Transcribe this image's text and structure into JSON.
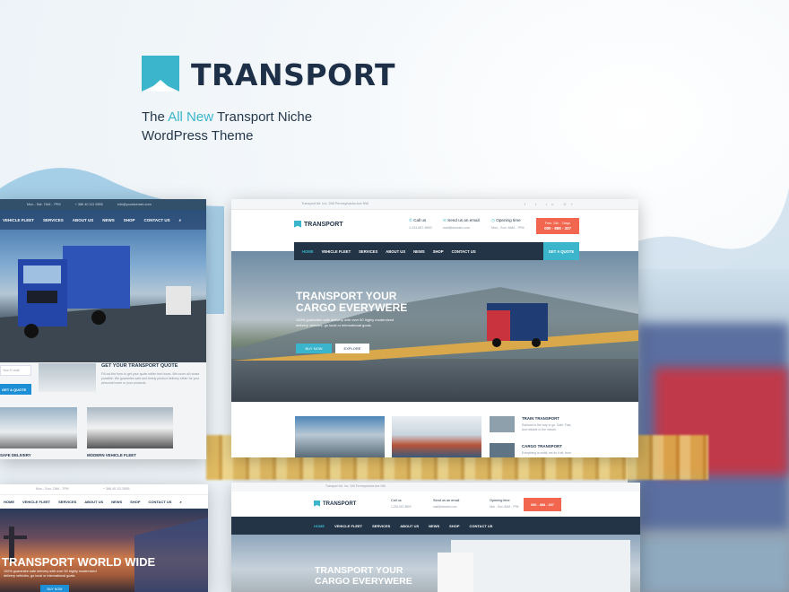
{
  "brand": {
    "name": "TRANSPORT",
    "tagline_pre": "The ",
    "tagline_hl": "All New",
    "tagline_post": " Transport Niche",
    "tagline_line2": "WordPress Theme",
    "accent": "#3ab5cb",
    "dark": "#1d3048"
  },
  "left_top": {
    "topbar": [
      "Mon - Sat: 7AM - 7PM",
      "+ 386 40 111 5555",
      "info@yourdomain.com"
    ],
    "nav": [
      "VEHICLE FLEET",
      "SERVICES",
      "ABOUT US",
      "NEWS",
      "SHOP",
      "CONTACT US"
    ],
    "quote_title": "GET YOUR TRANSPORT QUOTE",
    "quote_text": "Fill out the form to get your quote within few hours. We cover all routes possible. We guarantee safe and timely product delivery either for your personal home or your products.",
    "input_placeholder": "Your E-mail",
    "quote_button": "GET A QUOTE",
    "captions": [
      "SAFE DELIVERY",
      "MODERN VEHICLE FLEET"
    ]
  },
  "main": {
    "address": "Transport ltd. Inc. 208 Pennsylvania Ave NW",
    "social": "f  t  in  G+",
    "logo": "TRANSPORT",
    "call_title": "Call us",
    "call_sub": "1-234-567-8900",
    "email_title": "Send us an email",
    "email_sub": "mail@domain.com",
    "hours_title": "Opening time",
    "hours_sub": "Mon - Sun: 8AM - 7PM",
    "cta_top": "Free, 24h - 7days",
    "cta_phone": "080 - 888 - 337",
    "nav": [
      "HOME",
      "VEHICLE FLEET",
      "SERVICES",
      "ABOUT US",
      "NEWS",
      "SHOP",
      "CONTACT US"
    ],
    "get_quote": "GET A QUOTE",
    "hero_title_1": "TRANSPORT YOUR",
    "hero_title_2": "CARGO EVERYWERE",
    "hero_sub": "100% guarantee safe delivery with over 50 highly modernized delivery vehicles, go local or international goals",
    "btn_primary": "BUY NOW",
    "btn_secondary": "EXPLORE",
    "services": [
      {
        "title": "TRAIN TRANSPORT",
        "desc": "Railroad is the way to go. Safe, Fast, and reliable to the minute."
      },
      {
        "title": "CARGO TRANSPORT",
        "desc": "Everything is small, we do it all, from"
      }
    ]
  },
  "bottom_left": {
    "topbar": [
      "Mon - Sun: 7AM - 7PM",
      "+ 386 40 111 5555"
    ],
    "nav": [
      "HOME",
      "VEHICLE FLEET",
      "SERVICES",
      "ABOUT US",
      "NEWS",
      "SHOP",
      "CONTACT US"
    ],
    "hero_title": "TRANSPORT WORLD WIDE",
    "hero_sub": "100% guarantee safe delivery with over 50 highly modernized delivery vehicles, go local or international goals",
    "btn": "BUY NOW"
  },
  "bottom_right": {
    "address": "Transport ltd. Inc. 208 Pennsylvania Ave NW",
    "logo": "TRANSPORT",
    "call_title": "Call us",
    "call_sub": "1-234-567-8900",
    "email_title": "Send us an email",
    "email_sub": "mail@domain.com",
    "hours_title": "Opening time",
    "hours_sub": "Mon - Sun: 8AM - 7PM",
    "cta_phone": "080 - 888 - 337",
    "nav": [
      "HOME",
      "VEHICLE FLEET",
      "SERVICES",
      "ABOUT US",
      "NEWS",
      "SHOP",
      "CONTACT US"
    ],
    "hero_title_1": "TRANSPORT YOUR",
    "hero_title_2": "CARGO EVERYWERE"
  }
}
